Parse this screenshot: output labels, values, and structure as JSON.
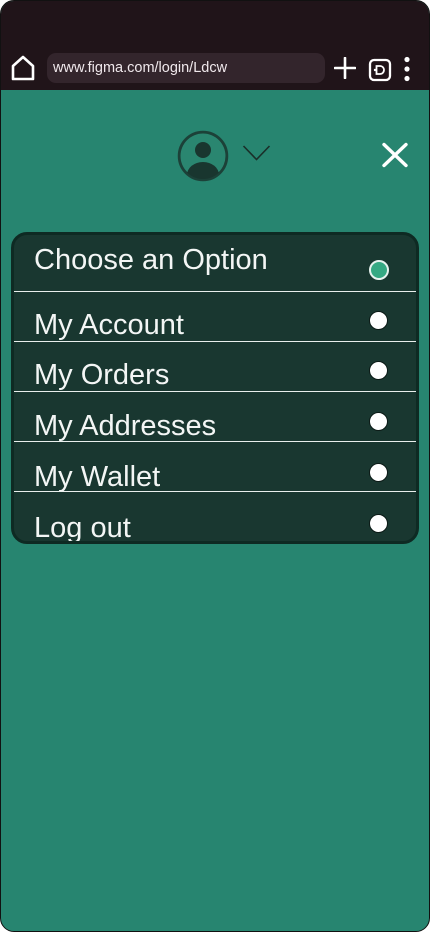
{
  "browser": {
    "url": "www.figma.com/login/Ldcw",
    "icons": [
      "home-icon",
      "plus-icon",
      "tab-switcher-icon",
      "more-vertical-icon"
    ]
  },
  "header": {
    "icons": [
      "user-avatar-icon",
      "chevron-down-icon",
      "close-icon"
    ]
  },
  "menu": {
    "items": [
      {
        "label": "Choose an Option",
        "selected": true
      },
      {
        "label": "My Account",
        "selected": false
      },
      {
        "label": "My Orders",
        "selected": false
      },
      {
        "label": "My Addresses",
        "selected": false
      },
      {
        "label": "My Wallet",
        "selected": false
      },
      {
        "label": "Log out",
        "selected": false
      }
    ]
  },
  "colors": {
    "page_background": "#278570",
    "browser_bar": "#201419",
    "menu_card": "#193730",
    "menu_card_border": "#0e2a23",
    "selected_radio": "#35a983",
    "radio": "#ffffff",
    "text": "#f3f6f5"
  }
}
